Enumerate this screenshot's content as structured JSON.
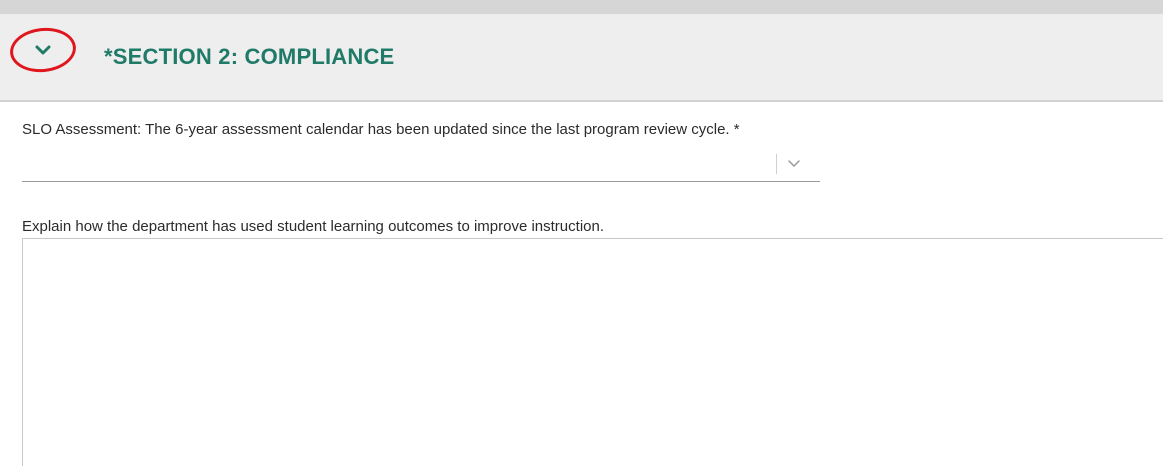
{
  "section": {
    "title": "*SECTION 2: COMPLIANCE",
    "toggle_icon": "chevron-down-icon",
    "annotation_color": "#e0161e",
    "title_color": "#1f7a68"
  },
  "questions": [
    {
      "label": "SLO Assessment: The 6-year assessment calendar has been updated since the last program review cycle.  *",
      "type": "select",
      "value": "",
      "icon": "chevron-down-icon"
    },
    {
      "label": "Explain how the department has used student learning outcomes to improve instruction.",
      "type": "textarea",
      "value": ""
    }
  ]
}
